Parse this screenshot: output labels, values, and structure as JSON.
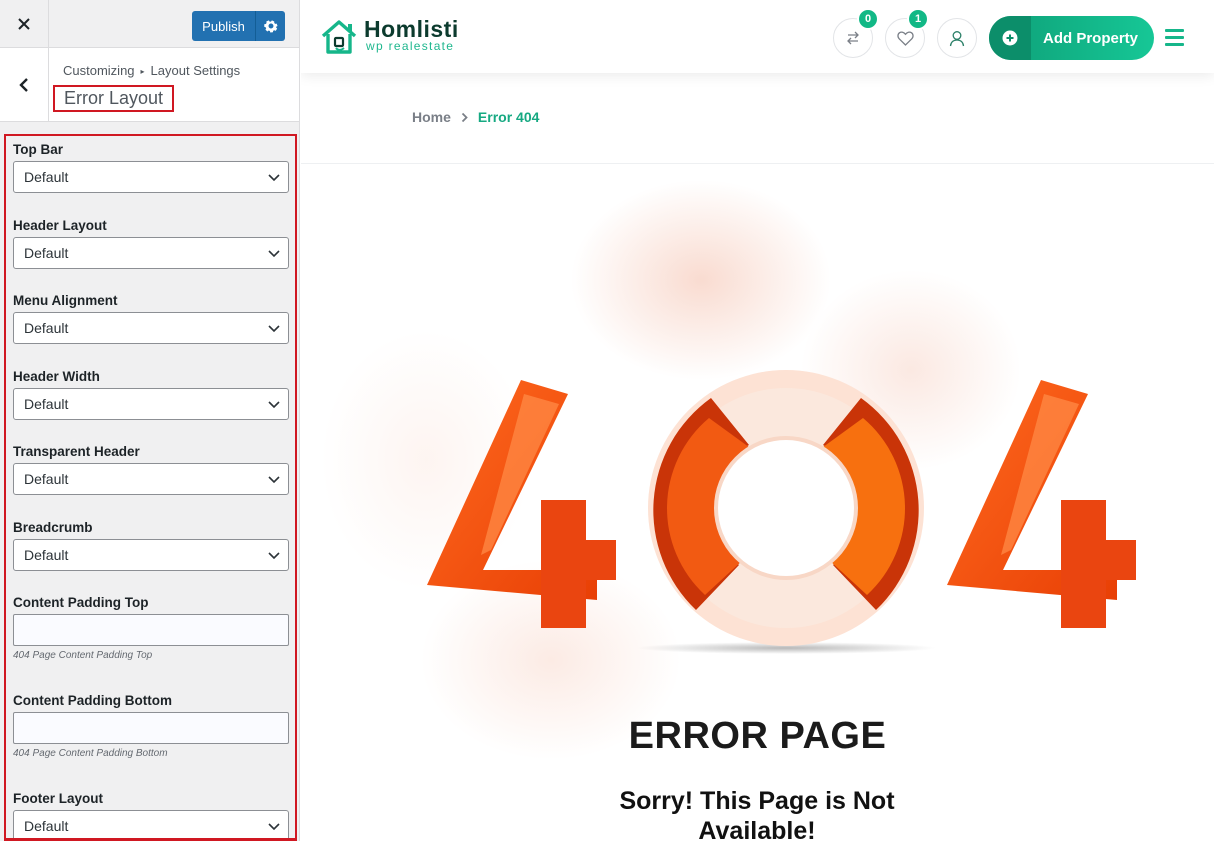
{
  "customizer": {
    "publish_label": "Publish",
    "breadcrumb": {
      "root": "Customizing",
      "parent": "Layout Settings"
    },
    "section_title": "Error Layout",
    "controls": [
      {
        "label": "Top Bar",
        "value": "Default"
      },
      {
        "label": "Header Layout",
        "value": "Default"
      },
      {
        "label": "Menu Alignment",
        "value": "Default"
      },
      {
        "label": "Header Width",
        "value": "Default"
      },
      {
        "label": "Transparent Header",
        "value": "Default"
      },
      {
        "label": "Breadcrumb",
        "value": "Default"
      },
      {
        "label": "Content Padding Top",
        "value": "",
        "description": "404 Page Content Padding Top"
      },
      {
        "label": "Content Padding Bottom",
        "value": "",
        "description": "404 Page Content Padding Bottom"
      },
      {
        "label": "Footer Layout",
        "value": "Default"
      }
    ]
  },
  "site": {
    "logo_name": "Homlisti",
    "logo_tagline": "wp realestate",
    "compare_count": "0",
    "wishlist_count": "1",
    "add_property_label": "Add Property",
    "breadcrumb": {
      "home": "Home",
      "current": "Error 404"
    },
    "error_graphic": "404",
    "error_title": "ERROR PAGE",
    "error_message": "Sorry! This Page is Not Available!",
    "colors": {
      "brand": "#16b68a",
      "accent_orange": "#f04a0e",
      "wp_blue": "#2271b1"
    }
  }
}
